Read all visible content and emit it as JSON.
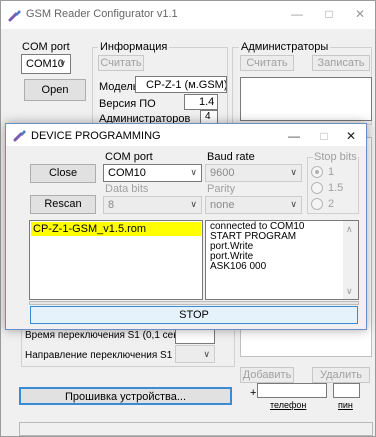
{
  "app": {
    "title": "GSM Reader Configurator v1.1",
    "minimize": "—",
    "maximize": "□",
    "close": "✕"
  },
  "com": {
    "label": "COM port",
    "value": "COM10",
    "open_label": "Open"
  },
  "info": {
    "group_label": "Информация",
    "read_label": "Считать",
    "model_label": "Модель",
    "model_value": "CP-Z-1 (м.GSM)",
    "version_label": "Версия ПО",
    "version_value": "1.4",
    "admins_label": "Администраторов",
    "admins_value": "4"
  },
  "admins": {
    "group_label": "Администраторы",
    "read_label": "Считать",
    "write_label": "Записать",
    "add_label": "Добавить",
    "delete_label": "Удалить",
    "phone_prefix": "+",
    "phone_caption": "телефон",
    "pin_caption": "пин"
  },
  "settings": {
    "switch_time_label": "Время переключения S1 (0,1 сек)",
    "switch_dir_label": "Направление переключения S1"
  },
  "firmware_button": "Прошивка устройства...",
  "dialog": {
    "title": "DEVICE PROGRAMMING",
    "minimize": "—",
    "maximize": "□",
    "close": "✕",
    "close_btn": "Close",
    "rescan_btn": "Rescan",
    "com_port_label": "COM port",
    "com_port_value": "COM10",
    "baud_label": "Baud rate",
    "baud_value": "9600",
    "stop_bits_label": "Stop bits",
    "stop_bits_options": [
      "1",
      "1.5",
      "2"
    ],
    "data_bits_label": "Data bits",
    "data_bits_value": "8",
    "parity_label": "Parity",
    "parity_value": "none",
    "file": "CP-Z-1-GSM_v1.5.rom",
    "log": [
      "connected to COM10",
      "START PROGRAM",
      "port.Write",
      "port.Write",
      "ASK106 000"
    ],
    "stop_btn": "STOP"
  },
  "colors": {
    "selection": "#ffff00",
    "stop_border": "#3a8bd4",
    "stop_bg": "#e5f1fb"
  }
}
